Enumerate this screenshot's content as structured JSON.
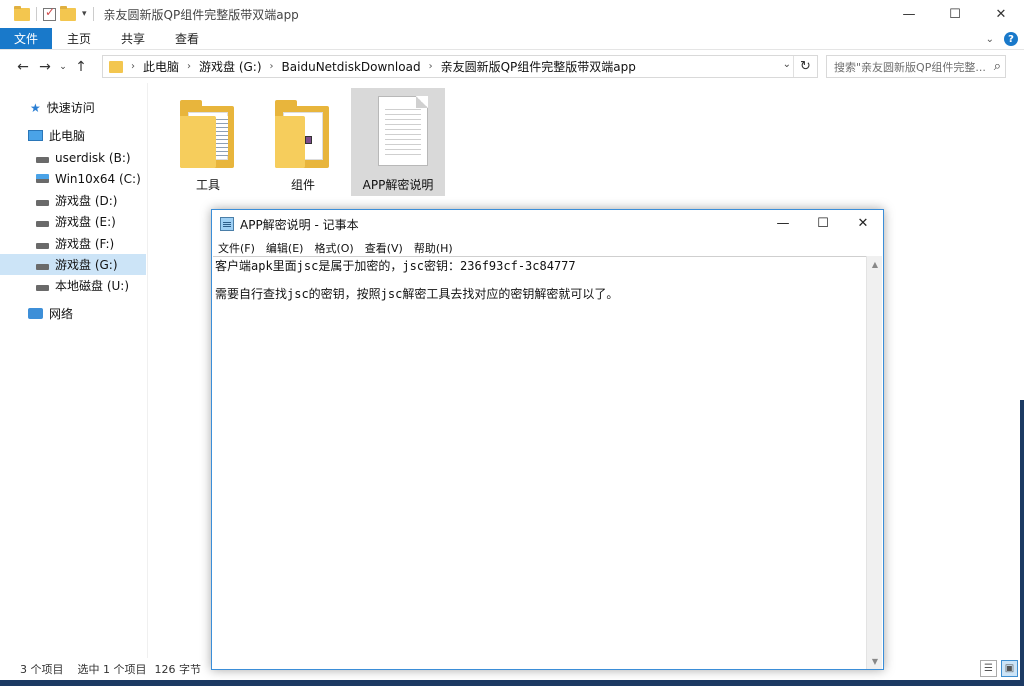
{
  "window": {
    "title": "亲友圆新版QP组件完整版带双端app",
    "minimize_glyph": "—",
    "maximize_glyph": "☐",
    "close_glyph": "✕"
  },
  "quick_access_toolbar": {
    "icons": [
      "folder-icon",
      "properties-checkmark-icon",
      "new-folder-icon",
      "customize-dropdown-icon"
    ]
  },
  "ribbon": {
    "tabs": [
      {
        "label": "文件",
        "active": true
      },
      {
        "label": "主页"
      },
      {
        "label": "共享"
      },
      {
        "label": "查看"
      }
    ],
    "accent_color": "#1979ca"
  },
  "navigation": {
    "back_glyph": "←",
    "forward_glyph": "→",
    "recent_glyph": "⌄",
    "up_glyph": "↑",
    "breadcrumb": [
      "此电脑",
      "游戏盘 (G:)",
      "BaiduNetdiskDownload",
      "亲友圆新版QP组件完整版带双端app"
    ],
    "breadcrumb_separator": "›",
    "refresh_glyph": "↻",
    "search_placeholder": "搜索\"亲友圆新版QP组件完整...",
    "search_glyph": "⌕"
  },
  "sidebar": {
    "items": [
      {
        "label": "快速访问",
        "icon": "star-icon"
      },
      {
        "label": "此电脑",
        "icon": "computer-icon"
      },
      {
        "label": "userdisk (B:)",
        "icon": "drive-icon"
      },
      {
        "label": "Win10x64 (C:)",
        "icon": "windows-drive-icon"
      },
      {
        "label": "游戏盘 (D:)",
        "icon": "drive-icon"
      },
      {
        "label": "游戏盘 (E:)",
        "icon": "drive-icon"
      },
      {
        "label": "游戏盘 (F:)",
        "icon": "drive-icon"
      },
      {
        "label": "游戏盘 (G:)",
        "icon": "drive-icon",
        "selected": true
      },
      {
        "label": "本地磁盘 (U:)",
        "icon": "drive-icon"
      },
      {
        "label": "网络",
        "icon": "network-icon"
      }
    ]
  },
  "files": [
    {
      "label": "工具",
      "type": "folder"
    },
    {
      "label": "组件",
      "type": "folder"
    },
    {
      "label": "APP解密说明",
      "type": "text-document",
      "selected": true
    }
  ],
  "status_bar": {
    "item_count": "3 个项目",
    "selection": "选中 1 个项目",
    "size": "126 字节"
  },
  "notepad": {
    "title": "APP解密说明 - 记事本",
    "menu": [
      "文件(F)",
      "编辑(E)",
      "格式(O)",
      "查看(V)",
      "帮助(H)"
    ],
    "lines": [
      "客户端apk里面jsc是属于加密的，jsc密钥：236f93cf-3c84777",
      "需要自行查找jsc的密钥，按照jsc解密工具去找对应的密钥解密就可以了。"
    ],
    "border_color": "#3b8ed8"
  }
}
